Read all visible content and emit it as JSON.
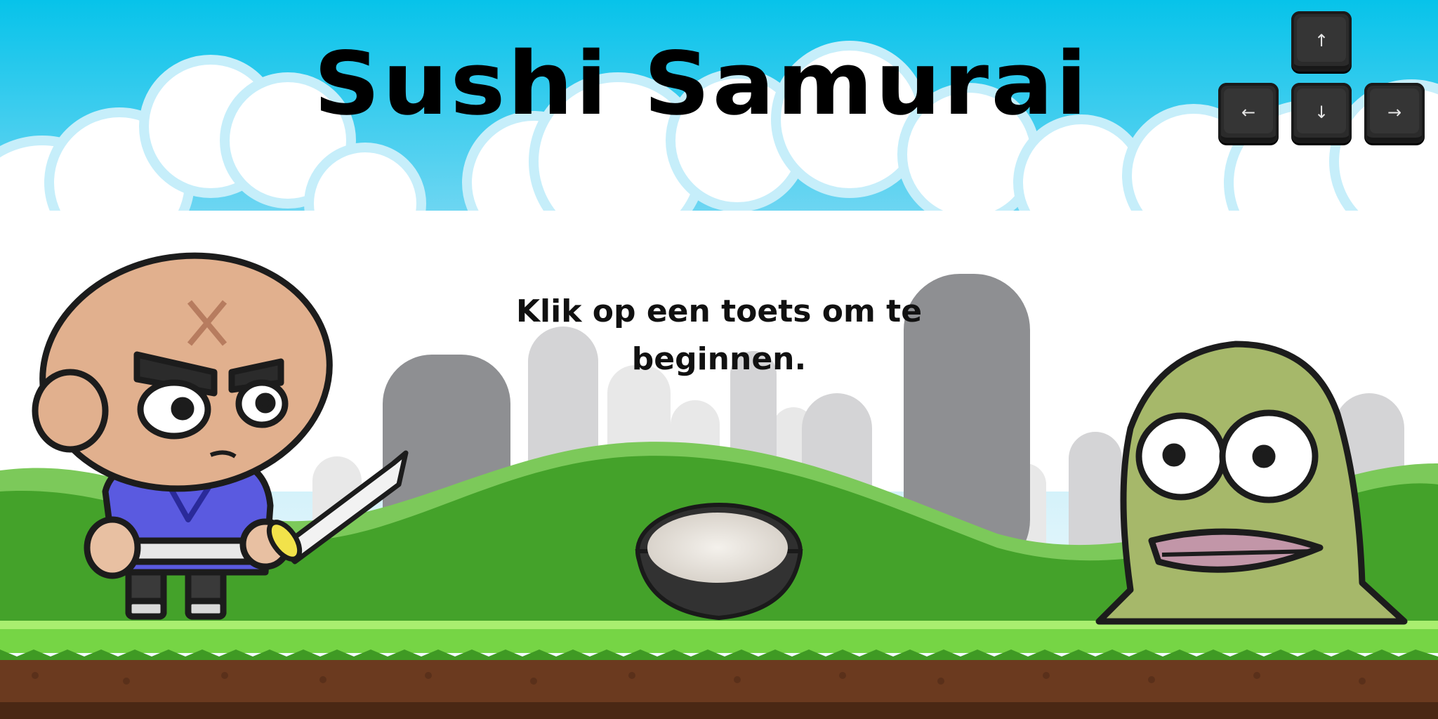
{
  "game": {
    "title": "Sushi Samurai",
    "instruction": "Klik op een toets om te beginnen."
  },
  "controls": {
    "up": "↑",
    "left": "←",
    "down": "↓",
    "right": "→"
  },
  "colors": {
    "sky_top": "#07c3ea",
    "sky_bottom": "#bfe9f7",
    "hills": "#4aa52e",
    "grass": "#7ad94a",
    "dirt": "#6b3a1f",
    "robe": "#5a5ae0",
    "fish": "#a6b86a"
  },
  "icons": [
    "arrow-up-key-icon",
    "arrow-left-key-icon",
    "arrow-down-key-icon",
    "arrow-right-key-icon"
  ]
}
